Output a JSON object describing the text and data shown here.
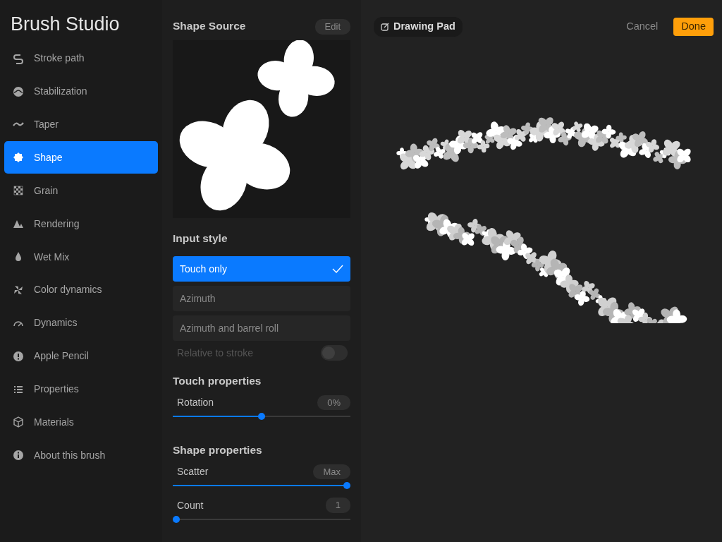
{
  "sidebar": {
    "title": "Brush Studio",
    "items": [
      {
        "label": "Stroke path",
        "selected": false
      },
      {
        "label": "Stabilization",
        "selected": false
      },
      {
        "label": "Taper",
        "selected": false
      },
      {
        "label": "Shape",
        "selected": true
      },
      {
        "label": "Grain",
        "selected": false
      },
      {
        "label": "Rendering",
        "selected": false
      },
      {
        "label": "Wet Mix",
        "selected": false
      },
      {
        "label": "Color dynamics",
        "selected": false
      },
      {
        "label": "Dynamics",
        "selected": false
      },
      {
        "label": "Apple Pencil",
        "selected": false
      },
      {
        "label": "Properties",
        "selected": false
      },
      {
        "label": "Materials",
        "selected": false
      },
      {
        "label": "About this brush",
        "selected": false
      }
    ]
  },
  "shape_source": {
    "title": "Shape Source",
    "edit_button": "Edit"
  },
  "input_style": {
    "title": "Input style",
    "options": [
      {
        "label": "Touch only",
        "selected": true
      },
      {
        "label": "Azimuth",
        "selected": false
      },
      {
        "label": "Azimuth and barrel roll",
        "selected": false
      }
    ],
    "toggle": {
      "label": "Relative to stroke",
      "on": false,
      "disabled": true
    }
  },
  "touch_properties": {
    "title": "Touch properties",
    "sliders": [
      {
        "label": "Rotation",
        "reading": "0%",
        "level": 0.5
      }
    ]
  },
  "shape_properties": {
    "title": "Shape properties",
    "sliders": [
      {
        "label": "Scatter",
        "reading": "Max",
        "level": 1
      },
      {
        "label": "Count",
        "reading": "1",
        "level": 0
      }
    ]
  },
  "drawing_pad": {
    "title": "Drawing Pad",
    "cancel": "Cancel",
    "done": "Done"
  }
}
